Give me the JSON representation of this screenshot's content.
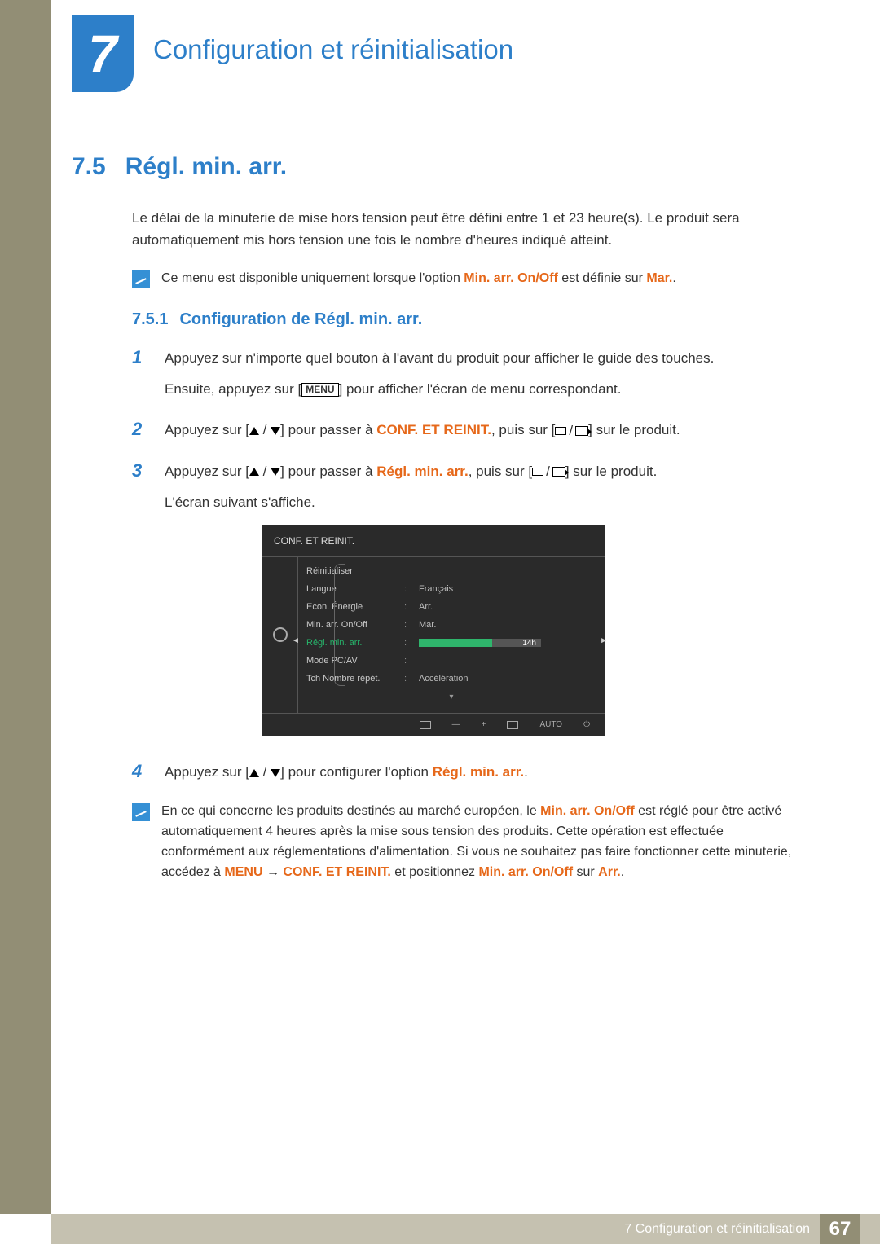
{
  "chapter": {
    "number": "7",
    "title": "Configuration et réinitialisation"
  },
  "section": {
    "number": "7.5",
    "title": "Régl. min. arr."
  },
  "intro": "Le délai de la minuterie de mise hors tension peut être défini entre 1 et 23 heure(s). Le produit sera automatiquement mis hors tension une fois le nombre d'heures indiqué atteint.",
  "note1": {
    "pre": "Ce menu est disponible uniquement lorsque l'option ",
    "opt": "Min. arr. On/Off",
    "mid": " est définie sur ",
    "val": "Mar.",
    "post": "."
  },
  "subsection": {
    "number": "7.5.1",
    "title": "Configuration de Régl. min. arr."
  },
  "steps": {
    "s1": {
      "line1": "Appuyez sur n'importe quel bouton à l'avant du produit pour afficher le guide des touches.",
      "line2a": "Ensuite, appuyez sur [",
      "menu": "MENU",
      "line2b": "] pour afficher l'écran de menu correspondant."
    },
    "s2": {
      "pre": "Appuyez sur [",
      "mid1": "] pour passer à ",
      "target": "CONF. ET REINIT.",
      "mid2": ", puis sur [",
      "post": "] sur le produit."
    },
    "s3": {
      "pre": "Appuyez sur [",
      "mid1": "] pour passer à ",
      "target": "Régl. min. arr.",
      "mid2": ", puis sur [",
      "post": "] sur le produit.",
      "after": "L'écran suivant s'affiche."
    },
    "s4": {
      "pre": "Appuyez sur [",
      "mid": "] pour configurer l'option ",
      "target": "Régl. min. arr.",
      "post": "."
    }
  },
  "osd": {
    "title": "CONF. ET REINIT.",
    "items": [
      {
        "label": "Réinitialiser",
        "value": ""
      },
      {
        "label": "Langue",
        "value": "Français"
      },
      {
        "label": "Econ. Énergie",
        "value": "Arr."
      },
      {
        "label": "Min. arr. On/Off",
        "value": "Mar."
      },
      {
        "label": "Régl. min. arr.",
        "value": "14h",
        "highlight": true,
        "slider_pct": 60
      },
      {
        "label": "Mode PC/AV",
        "value": ""
      },
      {
        "label": "Tch Nombre répét.",
        "value": "Accélération"
      }
    ],
    "footer_auto": "AUTO"
  },
  "note2": {
    "t1": "En ce qui concerne les produits destinés au marché européen, le ",
    "k1": "Min. arr. On/Off",
    "t2": " est réglé pour être activé automatiquement 4 heures après la mise sous tension des produits. Cette opération est effectuée conformément aux réglementations d'alimentation. Si vous ne souhaitez pas faire fonctionner cette minuterie, accédez à ",
    "k2": "MENU",
    "arrow": " → ",
    "k3": "CONF. ET REINIT.",
    "t3": " et positionnez ",
    "k4": "Min. arr. On/Off",
    "t4": " sur ",
    "k5": "Arr.",
    "t5": "."
  },
  "footer": {
    "label": "7 Configuration et réinitialisation",
    "page": "67"
  }
}
